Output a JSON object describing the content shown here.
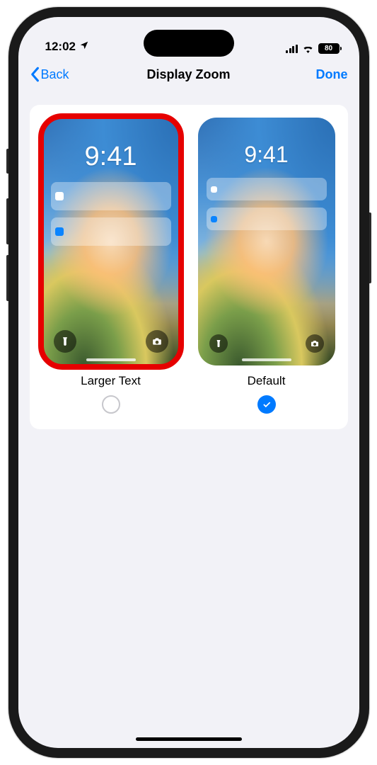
{
  "status": {
    "time": "12:02",
    "battery_pct": "80"
  },
  "nav": {
    "back_label": "Back",
    "title": "Display Zoom",
    "done_label": "Done"
  },
  "options": {
    "larger": {
      "label": "Larger Text",
      "preview_time": "9:41",
      "selected": false,
      "highlighted": true
    },
    "default": {
      "label": "Default",
      "preview_time": "9:41",
      "selected": true,
      "highlighted": false
    }
  }
}
